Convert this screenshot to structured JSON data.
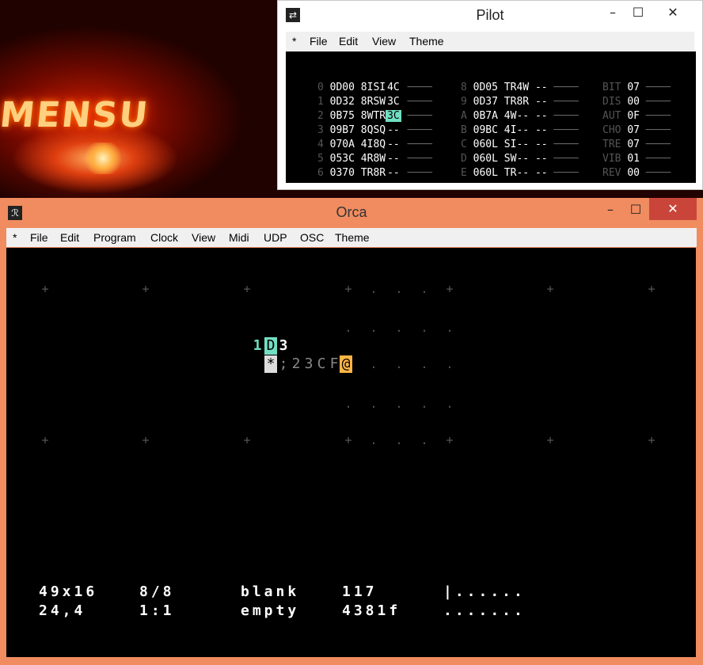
{
  "pilot": {
    "title": "Pilot",
    "menu": [
      "*",
      "File",
      "Edit",
      "View",
      "Theme"
    ],
    "channels_left": [
      {
        "idx": "0",
        "addr": "0D00",
        "code": "8ISI",
        "val": "4C",
        "hl": false
      },
      {
        "idx": "1",
        "addr": "0D32",
        "code": "8RSW",
        "val": "3C",
        "hl": false
      },
      {
        "idx": "2",
        "addr": "0B75",
        "code": "8WTR",
        "val": "3C",
        "hl": true
      },
      {
        "idx": "3",
        "addr": "09B7",
        "code": "8QSQ",
        "val": "--",
        "hl": false
      },
      {
        "idx": "4",
        "addr": "070A",
        "code": "4I8Q",
        "val": "--",
        "hl": false
      },
      {
        "idx": "5",
        "addr": "053C",
        "code": "4R8W",
        "val": "--",
        "hl": false
      },
      {
        "idx": "6",
        "addr": "0370",
        "code": "TR8R",
        "val": "--",
        "hl": false
      }
    ],
    "channels_right": [
      {
        "idx": "8",
        "addr": "0D05",
        "code": "TR4W",
        "val": "--"
      },
      {
        "idx": "9",
        "addr": "0D37",
        "code": "TR8R",
        "val": "--"
      },
      {
        "idx": "A",
        "addr": "0B7A",
        "code": "4W--",
        "val": "--"
      },
      {
        "idx": "B",
        "addr": "09BC",
        "code": "4I--",
        "val": "--"
      },
      {
        "idx": "C",
        "addr": "060L",
        "code": "SI--",
        "val": "--"
      },
      {
        "idx": "D",
        "addr": "060L",
        "code": "SW--",
        "val": "--"
      },
      {
        "idx": "E",
        "addr": "060L",
        "code": "TR--",
        "val": "--"
      }
    ],
    "effects": [
      {
        "name": "BIT",
        "val": "07"
      },
      {
        "name": "DIS",
        "val": "00"
      },
      {
        "name": "AUT",
        "val": "0F"
      },
      {
        "name": "CHO",
        "val": "07"
      },
      {
        "name": "TRE",
        "val": "07"
      },
      {
        "name": "VIB",
        "val": "01"
      },
      {
        "name": "REV",
        "val": "00"
      }
    ],
    "highlight_color": "#72dec2"
  },
  "orca": {
    "title": "Orca",
    "menu": [
      "*",
      "File",
      "Edit",
      "Program",
      "Clock",
      "View",
      "Midi",
      "UDP",
      "OSC",
      "Theme"
    ],
    "grid": {
      "row1": [
        "1",
        "D",
        "3"
      ],
      "row2": [
        "*",
        ";",
        "2",
        "3",
        "C",
        "F",
        "@"
      ]
    },
    "status": {
      "line1": [
        "49x16",
        "8/8",
        "blank",
        "117",
        "|......"
      ],
      "line2": [
        "24,4",
        "1:1",
        "empty",
        "4381f",
        "......."
      ]
    },
    "colors": {
      "accent": "#72dec2",
      "cursor": "#ffb545",
      "frame": "#f08c60"
    }
  },
  "icons": {
    "pilot_app": "pilot-icon",
    "orca_app": "orca-icon",
    "minimize": "minimize-icon",
    "maximize": "maximize-icon",
    "close": "close-icon"
  }
}
